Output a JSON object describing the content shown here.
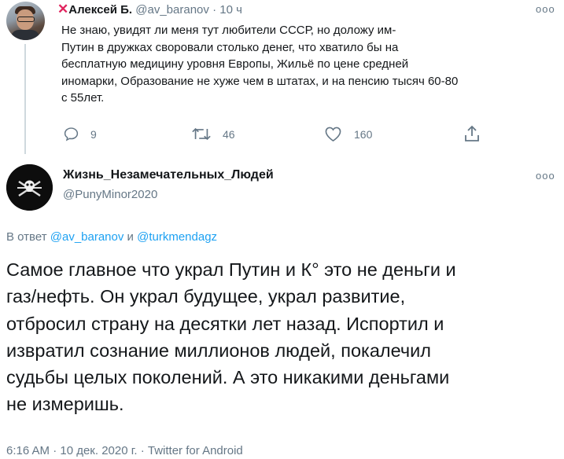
{
  "tweet1": {
    "prefix_icon": "x-mark",
    "author_name": "Алексей Б.",
    "handle": "@av_baranov",
    "separator": "·",
    "time": "10 ч",
    "body_lines": [
      "Не знаю, увидят ли меня тут любители СССР, но доложу им-",
      "Путин в дружках своровали столько денег, что хватило бы на",
      "бесплатную медицину уровня Европы, Жильё по цене средней",
      "иномарки, Образование не хуже чем в штатах, и на пенсию тысяч 60-80",
      "с 55лет."
    ],
    "more_label": "ooo",
    "actions": {
      "reply_count": "9",
      "retweet_count": "46",
      "like_count": "160"
    }
  },
  "tweet2": {
    "author_name": "Жизнь_Незамечательных_Людей",
    "handle": "@PunyMinor2020",
    "more_label": "ooo",
    "reply_prefix": "В ответ ",
    "reply_to_1": "@av_baranov",
    "reply_and": " и ",
    "reply_to_2": "@turkmendagz",
    "body_lines": [
      "Самое главное что украл Путин и К° это не деньги и",
      "газ/нефть. Он украл будущее, украл развитие,",
      "отбросил страну на десятки лет назад. Испортил и",
      "извратил сознание миллионов людей, покалечил",
      "судьбы целых поколений. А это никакими деньгами",
      "не измеришь."
    ],
    "timestamp": "6:16 AM · 10 дек. 2020 г. · Twitter for Android"
  },
  "colors": {
    "link": "#1da1f2",
    "muted": "#657786",
    "x_mark": "#e0245e",
    "thread_line": "#cfd9de"
  }
}
